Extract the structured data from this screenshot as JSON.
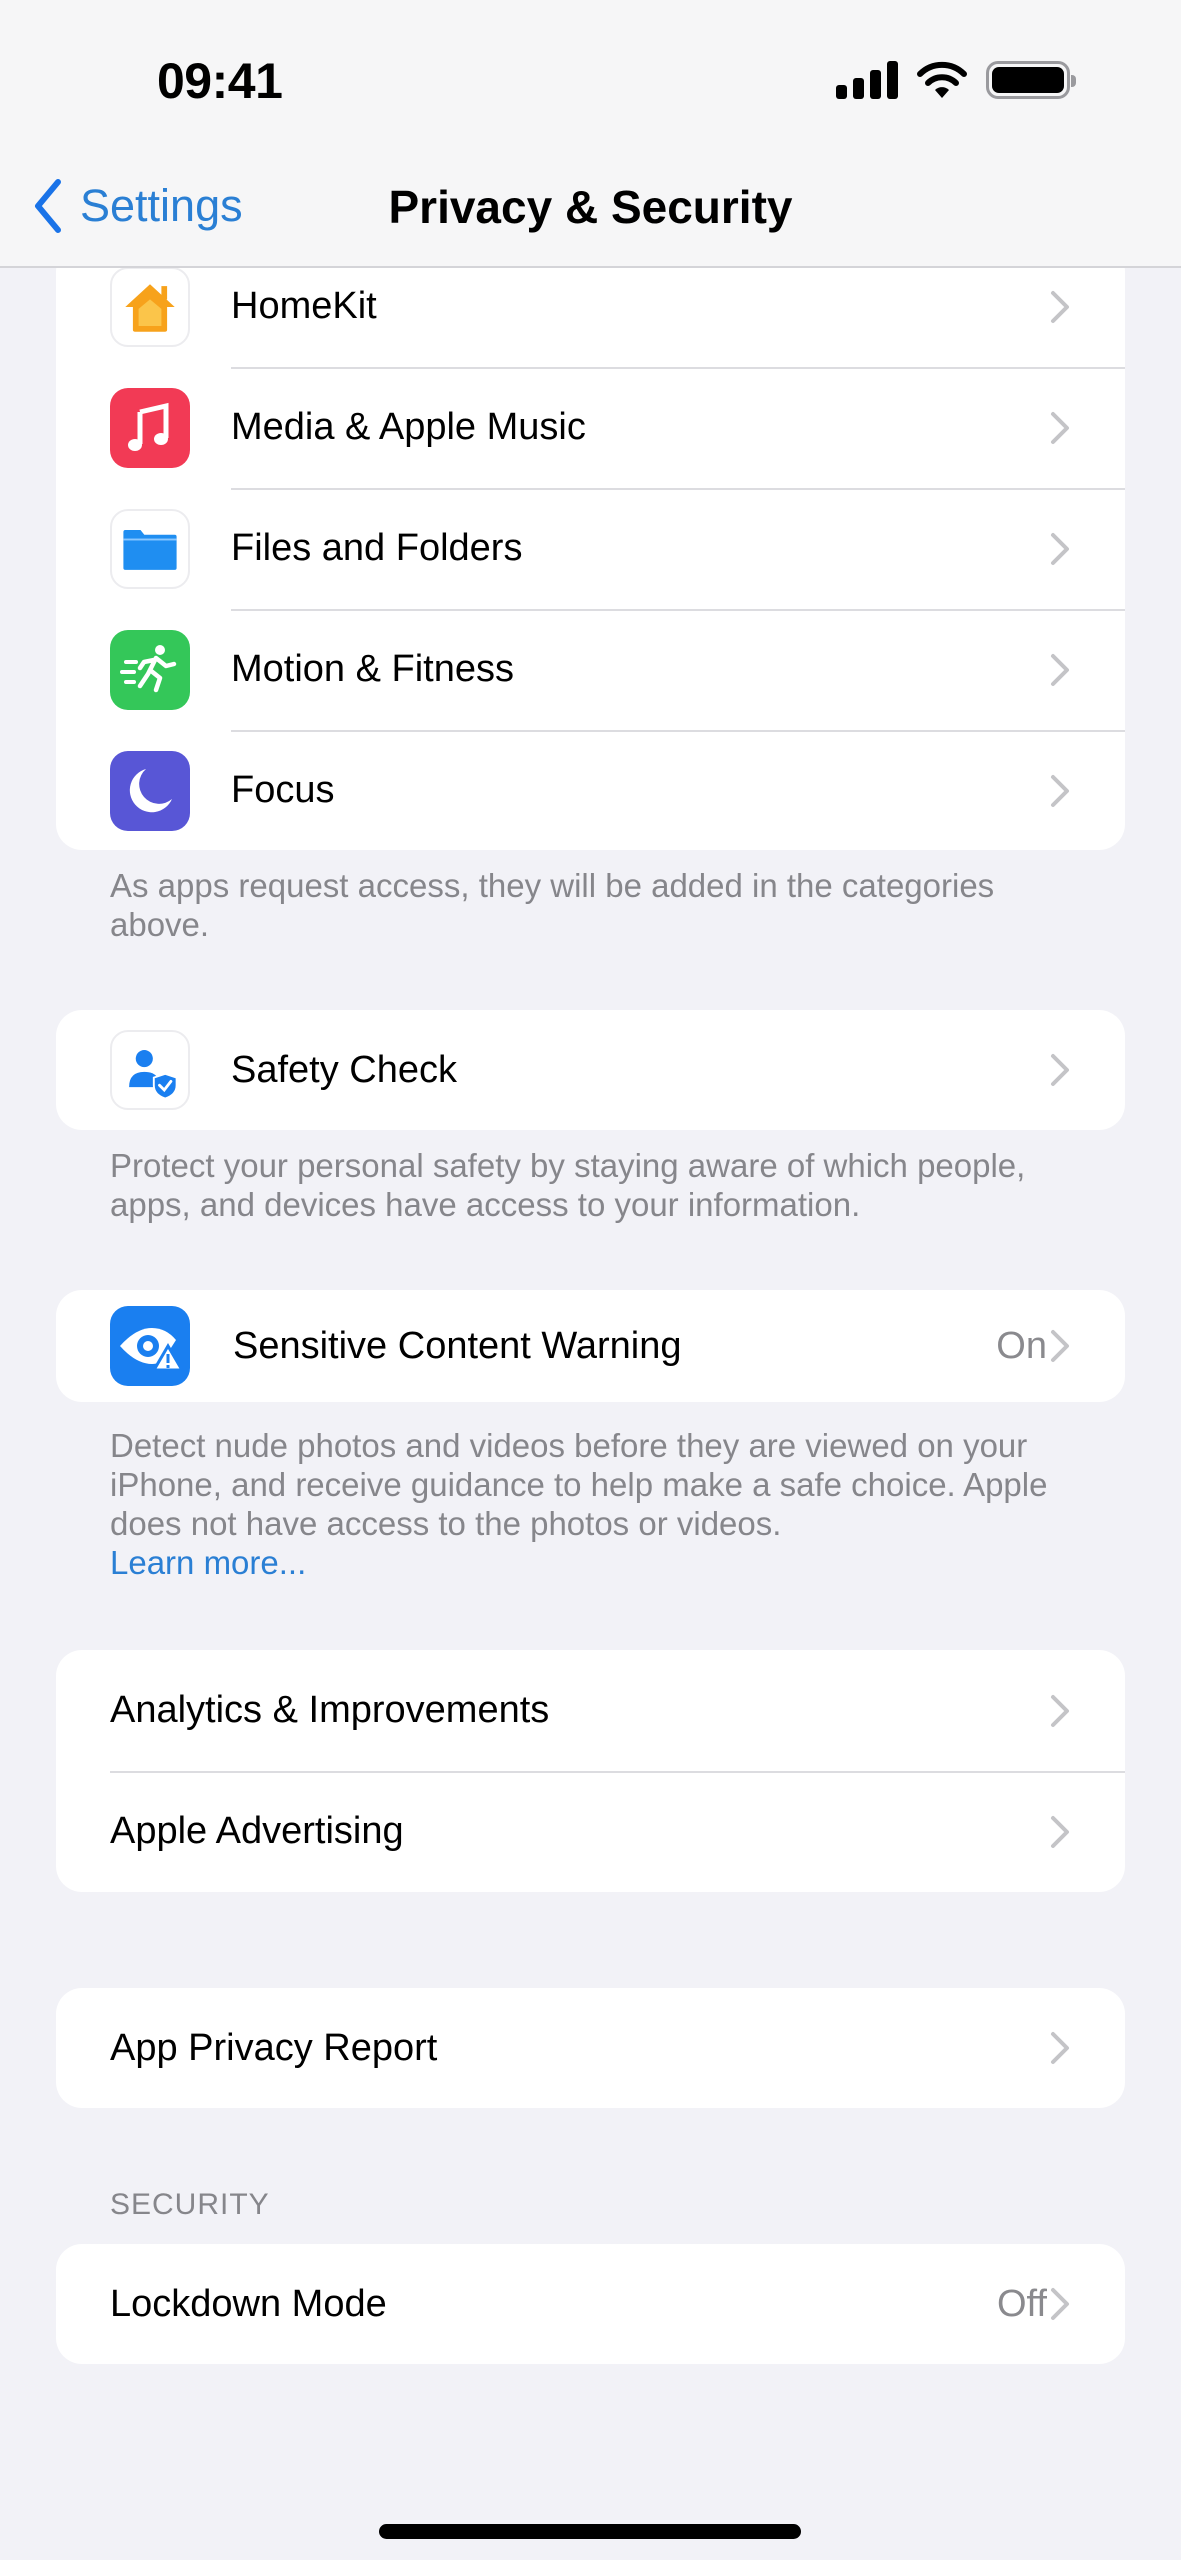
{
  "status_bar": {
    "time": "09:41",
    "icons": [
      "cellular-signal-icon",
      "wifi-icon",
      "battery-icon"
    ],
    "battery_level": 1.0
  },
  "nav": {
    "back_label": "Settings",
    "back_icon": "chevron-left-icon",
    "title": "Privacy & Security"
  },
  "colors": {
    "accent": "#2a7fd4",
    "background": "#f2f2f7",
    "secondary_text": "#86868b",
    "chevron": "#c4c4c7"
  },
  "groups": {
    "permissions": {
      "items": [
        {
          "label": "HomeKit",
          "icon": "home-icon",
          "icon_color": "#f7a21b"
        },
        {
          "label": "Media & Apple Music",
          "icon": "music-note-icon",
          "icon_color": "#f23a55"
        },
        {
          "label": "Files and Folders",
          "icon": "folder-icon",
          "icon_color": "#1f8ef1"
        },
        {
          "label": "Motion & Fitness",
          "icon": "running-figure-icon",
          "icon_color": "#34c759"
        },
        {
          "label": "Focus",
          "icon": "moon-icon",
          "icon_color": "#5856d6"
        }
      ],
      "footer": "As apps request access, they will be added in the categories above."
    },
    "safety": {
      "items": [
        {
          "label": "Safety Check",
          "icon": "person-shield-icon",
          "icon_color": "#1a7ff0"
        }
      ],
      "footer": "Protect your personal safety by staying aware of which people, apps, and devices have access to your information."
    },
    "sensitive": {
      "items": [
        {
          "label": "Sensitive Content Warning",
          "value": "On",
          "icon": "eye-warning-icon",
          "icon_color": "#1a7ff0"
        }
      ],
      "footer": "Detect nude photos and videos before they are viewed on your iPhone, and receive guidance to help make a safe choice. Apple does not have access to the photos or videos.",
      "footer_link": "Learn more..."
    },
    "analytics": {
      "items": [
        {
          "label": "Analytics & Improvements"
        },
        {
          "label": "Apple Advertising"
        }
      ]
    },
    "report": {
      "items": [
        {
          "label": "App Privacy Report"
        }
      ]
    },
    "security": {
      "header": "SECURITY",
      "items": [
        {
          "label": "Lockdown Mode",
          "value": "Off"
        }
      ]
    }
  }
}
